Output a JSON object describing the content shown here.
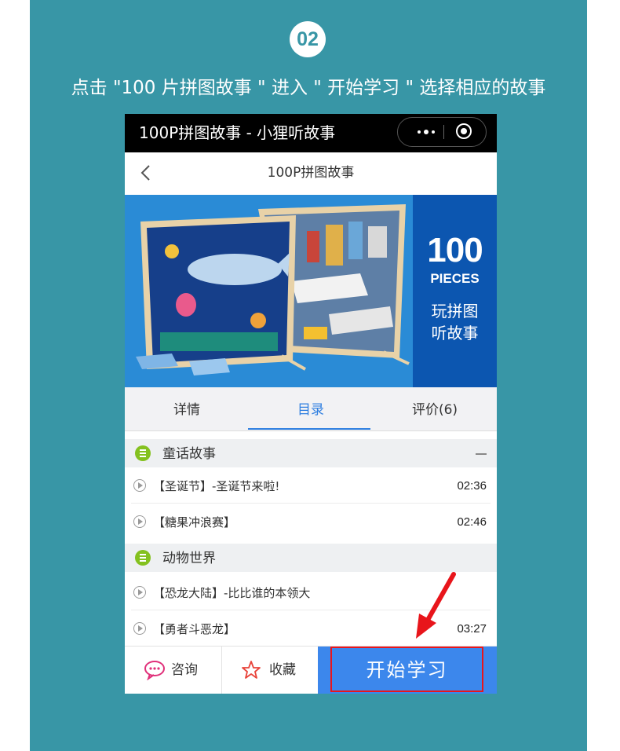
{
  "step": {
    "number": "02"
  },
  "instruction": "点击 \"100 片拼图故事 \" 进入 \" 开始学习 \" 选择相应的故事",
  "colors": {
    "panel": "#3896a6",
    "accent_blue": "#2f7fe0",
    "start_button": "#3c87ec",
    "highlight_red": "#e8151b",
    "section_icon": "#84c11f"
  },
  "topbar": {
    "title": "100P拼图故事 - 小狸听故事",
    "more_icon": "more-dots-icon",
    "close_icon": "target-close-icon"
  },
  "navbar": {
    "back_icon": "chevron-left-icon",
    "title": "100P拼图故事"
  },
  "banner": {
    "number": "100",
    "pieces": "PIECES",
    "slogan_line1": "玩拼图",
    "slogan_line2": "听故事"
  },
  "tabs": [
    {
      "label": "详情",
      "active": false
    },
    {
      "label": "目录",
      "active": true
    },
    {
      "label": "评价(6)",
      "active": false
    }
  ],
  "sections": [
    {
      "title": "童话故事",
      "items": [
        {
          "title": "【圣诞节】-圣诞节来啦!",
          "duration": "02:36"
        },
        {
          "title": "【糖果冲浪赛】",
          "duration": "02:46"
        }
      ]
    },
    {
      "title": "动物世界",
      "items": [
        {
          "title": "【恐龙大陆】-比比谁的本领大",
          "duration": ""
        },
        {
          "title": "【勇者斗恶龙】",
          "duration": "03:27"
        }
      ]
    }
  ],
  "bottombar": {
    "consult_label": "咨询",
    "favorite_label": "收藏",
    "start_label": "开始学习"
  }
}
